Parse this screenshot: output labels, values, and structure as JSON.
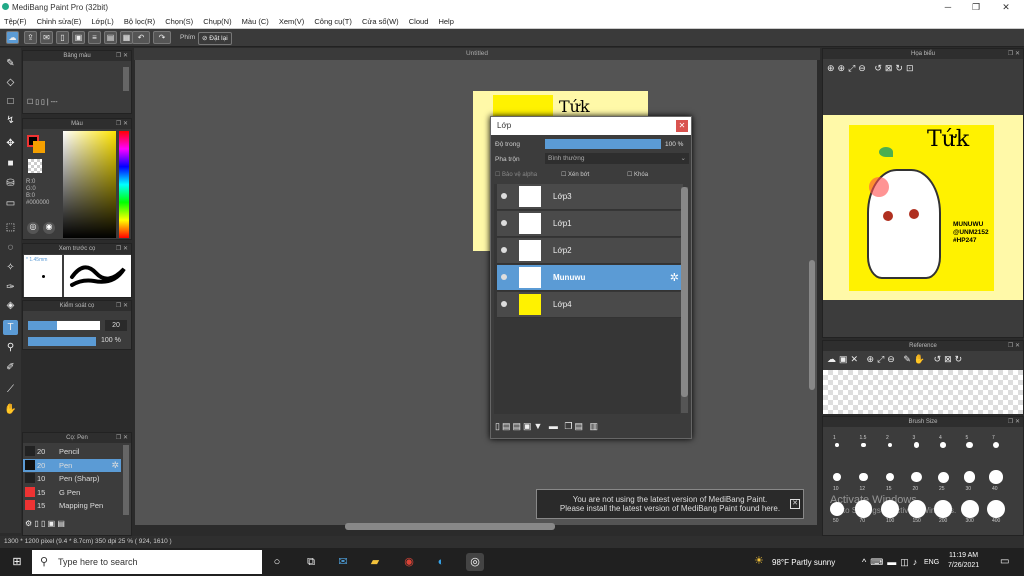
{
  "window": {
    "title": "MediBang Paint Pro (32bit)"
  },
  "menu": [
    "Tệp(F)",
    "Chỉnh sửa(E)",
    "Lớp(L)",
    "Bộ lọc(R)",
    "Chọn(S)",
    "Chụp(N)",
    "Màu (C)",
    "Xem(V)",
    "Công cụ(T)",
    "Cửa sổ(W)",
    "Cloud",
    "Help"
  ],
  "toolbar": {
    "phim_label": "Phím",
    "undo_label": "Đặt lại"
  },
  "canvas": {
    "tab_title": "Untitled"
  },
  "panels": {
    "color_palette": "Bảng màu",
    "color": "Màu",
    "color_values": [
      "R:0",
      "G:0",
      "B:0",
      "#000000"
    ],
    "brush_preview": "Xem trước cọ",
    "brush_preview_size": "* 1.45mm",
    "brush_control": "Kiểm soát cọ",
    "brush_size_value": "20",
    "opacity_value": "100 %",
    "brush_list_title": "Cọ: Pen",
    "navigator": "Họa biểu",
    "reference": "Reference",
    "brush_size": "Brush Size"
  },
  "brushes": [
    {
      "size": "20",
      "name": "Pencil",
      "color": "#222",
      "selected": false
    },
    {
      "size": "20",
      "name": "Pen",
      "color": "#111",
      "selected": true
    },
    {
      "size": "10",
      "name": "Pen (Sharp)",
      "color": "#222",
      "selected": false
    },
    {
      "size": "15",
      "name": "G Pen",
      "color": "#e33",
      "selected": false
    },
    {
      "size": "15",
      "name": "Mapping Pen",
      "color": "#e33",
      "selected": false
    }
  ],
  "layer_dialog": {
    "title": "Lớp",
    "opacity_label": "Độ trong",
    "opacity_value": "100 %",
    "blend_label": "Pha trộn",
    "blend_value": "Bình thường",
    "protect_alpha": "Bảo vệ alpha",
    "clipping": "Xén bớt",
    "lock": "Khóa",
    "layers": [
      {
        "name": "Lớp3",
        "selected": false
      },
      {
        "name": "Lớp1",
        "selected": false
      },
      {
        "name": "Lớp2",
        "selected": false
      },
      {
        "name": "Munuwu",
        "selected": true
      },
      {
        "name": "Lớp4",
        "selected": false
      }
    ]
  },
  "artwork": {
    "title_text": "Tứk",
    "caption": [
      "MUNUWU",
      "@UNM2152",
      "#HP247"
    ],
    "bg": "#fff200"
  },
  "brush_sizes": [
    "1",
    "1.5",
    "2",
    "3",
    "4",
    "5",
    "7",
    "10",
    "12",
    "15",
    "20",
    "25",
    "30",
    "40",
    "50",
    "70",
    "100",
    "150",
    "200",
    "300",
    "400"
  ],
  "notification": {
    "line1": "You are not using the latest version of MediBang Paint.",
    "line2": "Please install the latest version of MediBang Paint found here."
  },
  "watermark": {
    "line1": "Activate Windows",
    "line2": "Go to Settings to activate Windows."
  },
  "status": {
    "text": "1300 * 1200 pixel   (9.4 * 8.7cm)   350 dpi   25 %   ( 924, 1610 )"
  },
  "taskbar": {
    "search_placeholder": "Type here to search",
    "weather": "98°F  Partly sunny",
    "lang": "ENG",
    "time": "11:19 AM",
    "date": "7/26/2021"
  },
  "colors": {
    "accent": "#5b9bd5",
    "panel": "#3c3c3c",
    "yellow": "#fff200"
  }
}
